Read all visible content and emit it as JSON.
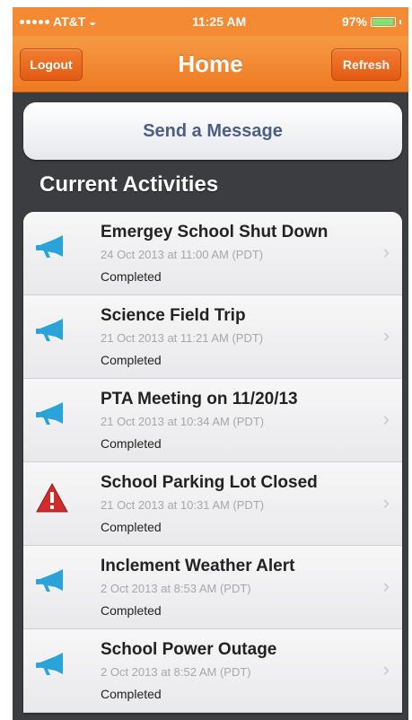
{
  "status_bar": {
    "carrier": "AT&T",
    "time": "11:25 AM",
    "battery": "97%"
  },
  "nav": {
    "title": "Home",
    "left_button": "Logout",
    "right_button": "Refresh"
  },
  "send_message_label": "Send a Message",
  "section_title": "Current Activities",
  "activities": [
    {
      "title": "Emergey School Shut Down",
      "date": "24 Oct 2013 at 11:00 AM (PDT)",
      "status": "Completed",
      "icon": "megaphone-icon"
    },
    {
      "title": "Science Field Trip",
      "date": "21 Oct 2013 at 11:21 AM (PDT)",
      "status": "Completed",
      "icon": "megaphone-icon"
    },
    {
      "title": "PTA Meeting on 11/20/13",
      "date": "21 Oct 2013 at 10:34 AM (PDT)",
      "status": "Completed",
      "icon": "megaphone-icon"
    },
    {
      "title": "School Parking Lot Closed",
      "date": "21 Oct 2013 at 10:31 AM (PDT)",
      "status": "Completed",
      "icon": "warning-icon"
    },
    {
      "title": "Inclement Weather Alert",
      "date": "2 Oct 2013 at 8:53 AM (PDT)",
      "status": "Completed",
      "icon": "megaphone-icon"
    },
    {
      "title": "School Power Outage",
      "date": "2 Oct 2013 at 8:52 AM (PDT)",
      "status": "Completed",
      "icon": "megaphone-icon"
    }
  ],
  "colors": {
    "accent": "#f48a34",
    "background": "#3b3d40",
    "megaphone": "#2aa3d8",
    "warning": "#d02c2c"
  }
}
